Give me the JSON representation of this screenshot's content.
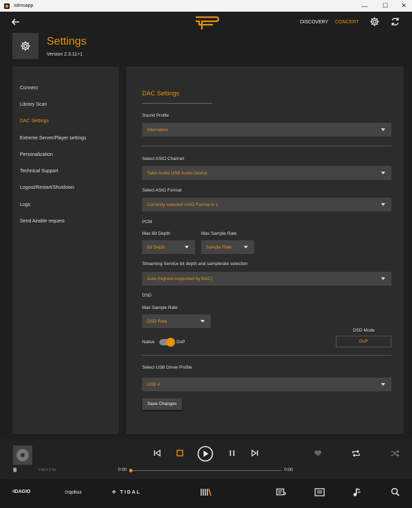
{
  "window": {
    "title": "xdmsapp",
    "minimize": "—",
    "maximize": "☐",
    "close": "✕"
  },
  "header": {
    "nav_discovery": "DISCOVERY",
    "nav_concert": "CONCERT",
    "title": "Settings",
    "version": "Version 2.3.11+1"
  },
  "sidebar": {
    "items": [
      {
        "label": "Connect"
      },
      {
        "label": "Library Scan"
      },
      {
        "label": "DAC Settings"
      },
      {
        "label": "Extreme Server/Player settings"
      },
      {
        "label": "Personalization"
      },
      {
        "label": "Technical Support"
      },
      {
        "label": "Logout/Restart/Shutdown"
      },
      {
        "label": "Logs"
      },
      {
        "label": "Send Airable request"
      }
    ],
    "active_index": 2
  },
  "dac": {
    "title": "DAC Settings",
    "sound_profile_label": "Sound Profile",
    "sound_profile_value": "Alternative",
    "asio_channel_label": "Select ASIO Channel",
    "asio_channel_value": "Taiko Audio USB Audio Device",
    "asio_format_label": "Select ASIO Format",
    "asio_format_value": "Currently selected ASIO Format is 1",
    "pcm_label": "PCM",
    "max_bit_depth_label": "Max Bit Depth",
    "bit_depth_value": "Bit Depth",
    "pcm_max_sample_rate_label": "Max Sample Rate",
    "sample_rate_value": "Sample Rate",
    "streaming_label": "Streaming Service bit depth and samplerate selection",
    "streaming_value": "Auto (highest supported by DAC)",
    "dsd_label": "DSD",
    "dsd_max_sample_rate_label": "Max Sample Rate",
    "dsd_rate_value": "DSD Rate",
    "dsd_mode_label": "DSD Mode",
    "dsd_mode_value": "DoP",
    "native_label": "Native",
    "dop_label": "DoP",
    "usb_profile_label": "Select USB Driver Profile",
    "usb_profile_value": "USB 4",
    "save_label": "Save Changes"
  },
  "player": {
    "level_glyph": "||||||||",
    "track_meta": "0 Bit 0.0 Hz",
    "time_elapsed": "0:00",
    "time_total": "0:00",
    "progress": 0
  },
  "bottom": {
    "idagio": "IDAGIO",
    "qobuz": "qobuz",
    "tidal": "TIDAL"
  },
  "colors": {
    "accent": "#e8920e",
    "panel": "#2c2c2c",
    "background": "#1e1e1e"
  }
}
